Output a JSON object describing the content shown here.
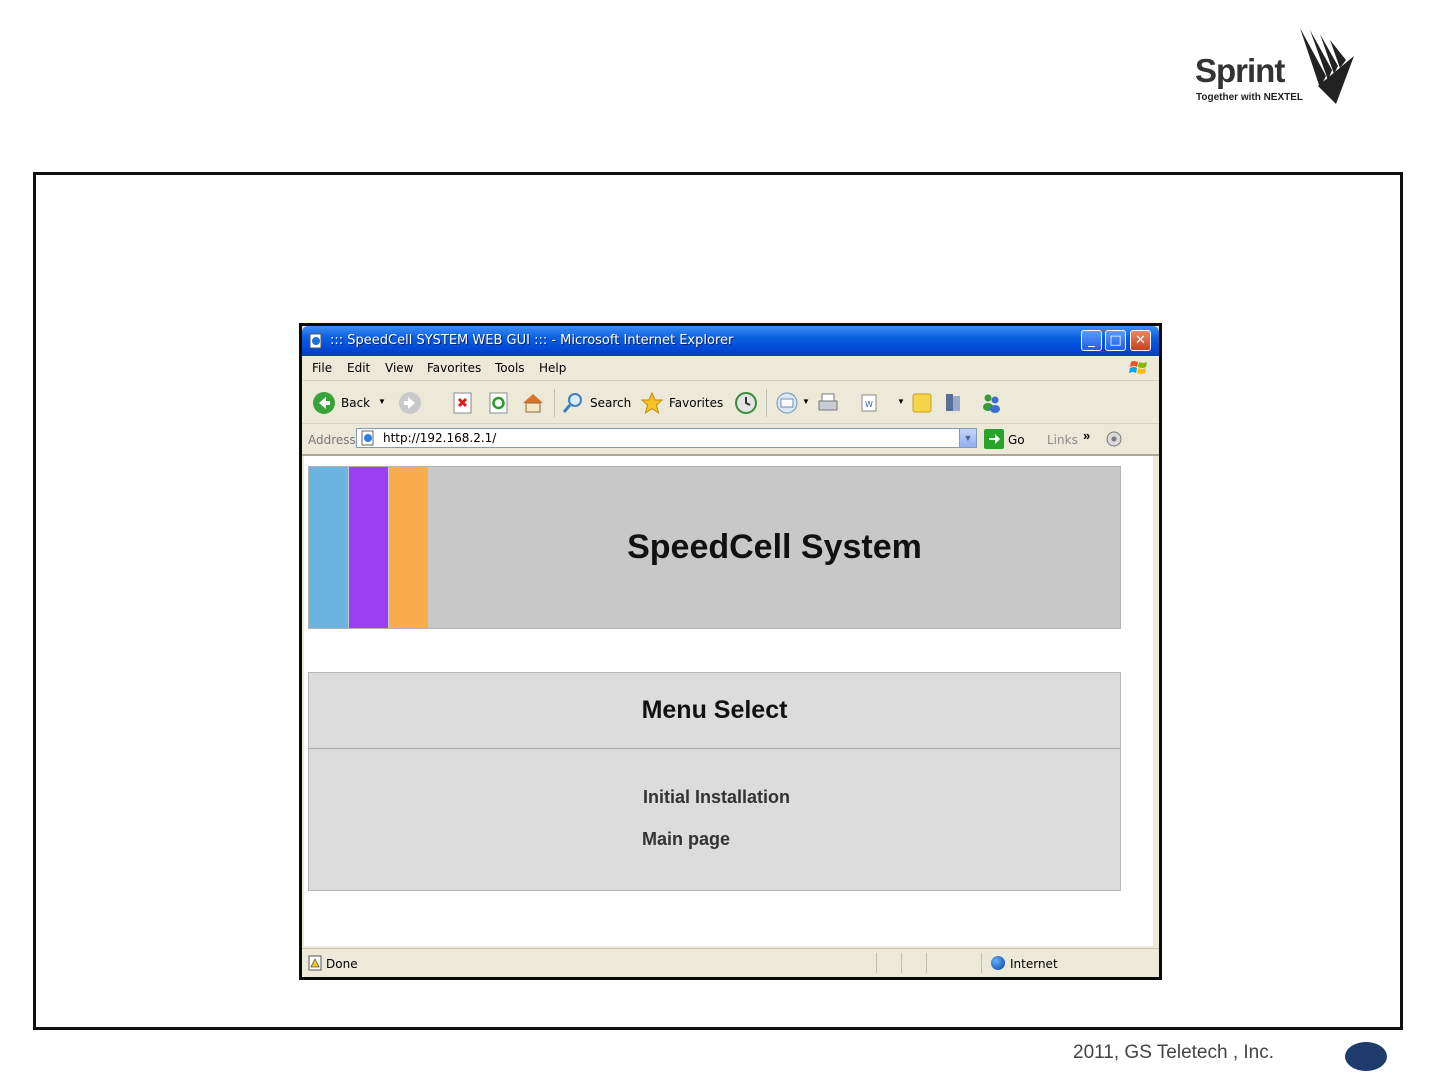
{
  "logo": {
    "wordmark": "Sprint",
    "tagline": "Together with NEXTEL"
  },
  "browser": {
    "title": "::: SpeedCell SYSTEM WEB GUI ::: - Microsoft Internet Explorer",
    "menu": [
      "File",
      "Edit",
      "View",
      "Favorites",
      "Tools",
      "Help"
    ],
    "toolbar": {
      "back_label": "Back",
      "search_label": "Search",
      "favorites_label": "Favorites"
    },
    "address": {
      "label": "Address",
      "url": "http://192.168.2.1/",
      "go_label": "Go",
      "links_label": "Links"
    },
    "status": {
      "text": "Done",
      "zone": "Internet"
    }
  },
  "page": {
    "banner_title": "SpeedCell System",
    "banner_colors": [
      "#6cb4e0",
      "#9b3ff2",
      "#fbac4c"
    ],
    "menu_title": "Menu Select",
    "menu_links": [
      "Initial Installation",
      "Main page"
    ]
  },
  "footer": {
    "copyright": "2011, GS Teletech , Inc."
  }
}
